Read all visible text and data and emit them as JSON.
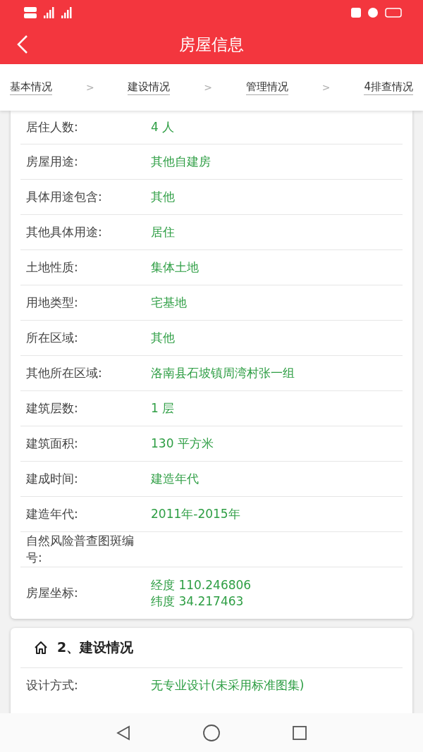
{
  "header": {
    "title": "房屋信息"
  },
  "steps": {
    "separator": ">",
    "items": [
      {
        "label": "基本情况"
      },
      {
        "label": "建设情况"
      },
      {
        "label": "管理情况"
      },
      {
        "label": "4排查情况"
      }
    ]
  },
  "basic_card": {
    "rows": [
      {
        "label": "居住人数:",
        "value": "4 人"
      },
      {
        "label": "房屋用途:",
        "value": "其他自建房"
      },
      {
        "label": "具体用途包含:",
        "value": "其他"
      },
      {
        "label": "其他具体用途:",
        "value": "居住"
      },
      {
        "label": "土地性质:",
        "value": "集体土地"
      },
      {
        "label": "用地类型:",
        "value": "宅基地"
      },
      {
        "label": "所在区域:",
        "value": "其他"
      },
      {
        "label": "其他所在区域:",
        "value": "洛南县石坡镇周湾村张一组"
      },
      {
        "label": "建筑层数:",
        "value": "1 层"
      },
      {
        "label": "建筑面积:",
        "value": "130 平方米"
      },
      {
        "label": "建成时间:",
        "value": "建造年代"
      },
      {
        "label": "建造年代:",
        "value": "2011年-2015年"
      },
      {
        "label": "自然风险普查图斑编号:"
      },
      {
        "label": "房屋坐标:",
        "values": [
          "经度 110.246806",
          "纬度 34.217463"
        ]
      }
    ]
  },
  "construction_card": {
    "title": "2、建设情况",
    "rows": [
      {
        "label": "设计方式:",
        "value": "无专业设计(未采用标准图集)"
      }
    ]
  }
}
